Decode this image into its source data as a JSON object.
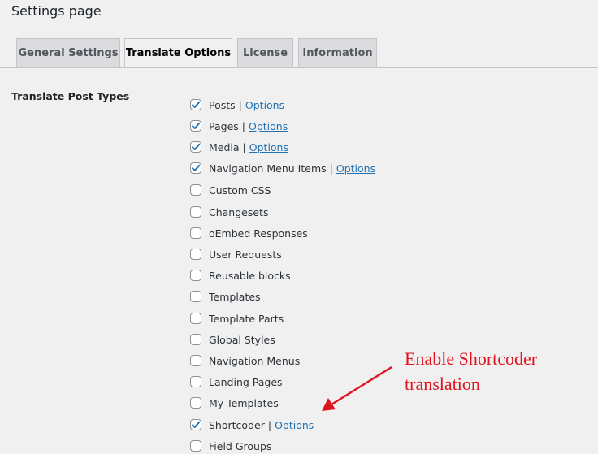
{
  "page": {
    "title": "Settings page"
  },
  "tabs": [
    {
      "label": "General Settings",
      "active": false
    },
    {
      "label": "Translate Options",
      "active": true
    },
    {
      "label": "License",
      "active": false
    },
    {
      "label": "Information",
      "active": false
    }
  ],
  "section": {
    "label": "Translate Post Types"
  },
  "post_types": [
    {
      "label": "Posts",
      "checked": true,
      "options_link": "Options"
    },
    {
      "label": "Pages",
      "checked": true,
      "options_link": "Options"
    },
    {
      "label": "Media",
      "checked": true,
      "options_link": "Options"
    },
    {
      "label": "Navigation Menu Items",
      "checked": true,
      "options_link": "Options"
    },
    {
      "label": "Custom CSS",
      "checked": false
    },
    {
      "label": "Changesets",
      "checked": false
    },
    {
      "label": "oEmbed Responses",
      "checked": false
    },
    {
      "label": "User Requests",
      "checked": false
    },
    {
      "label": "Reusable blocks",
      "checked": false
    },
    {
      "label": "Templates",
      "checked": false
    },
    {
      "label": "Template Parts",
      "checked": false
    },
    {
      "label": "Global Styles",
      "checked": false
    },
    {
      "label": "Navigation Menus",
      "checked": false
    },
    {
      "label": "Landing Pages",
      "checked": false
    },
    {
      "label": "My Templates",
      "checked": false
    },
    {
      "label": "Shortcoder",
      "checked": true,
      "options_link": "Options"
    },
    {
      "label": "Field Groups",
      "checked": false
    }
  ],
  "separator": "|",
  "annotation": {
    "line1": "Enable Shortcoder",
    "line2": "translation"
  },
  "colors": {
    "accent": "#2271b1",
    "annotation": "#e0141e",
    "background": "#f0f0f1"
  }
}
